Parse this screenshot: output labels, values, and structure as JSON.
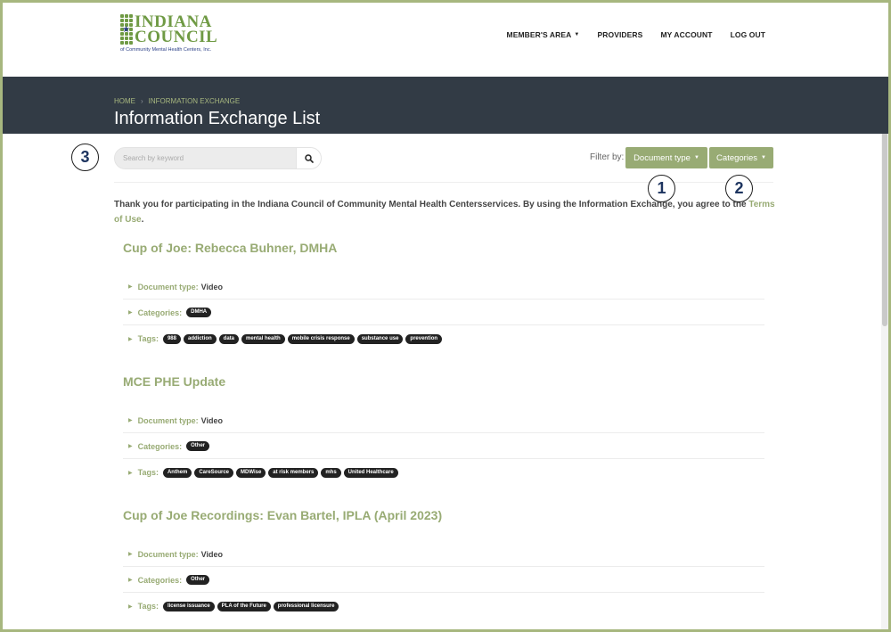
{
  "brand": {
    "logo_line1": "INDIANA",
    "logo_line2": "COUNCIL",
    "logo_tagline": "of Community Mental Health Centers, Inc.",
    "green": "#6f9a44",
    "navy": "#2b3f86"
  },
  "nav": {
    "items": [
      {
        "label": "MEMBER'S AREA",
        "has_dropdown": true
      },
      {
        "label": "PROVIDERS"
      },
      {
        "label": "MY ACCOUNT"
      },
      {
        "label": "LOG OUT"
      }
    ]
  },
  "breadcrumb": {
    "home": "HOME",
    "current": "INFORMATION EXCHANGE"
  },
  "page": {
    "title": "Information Exchange List"
  },
  "search": {
    "placeholder": "Search by keyword",
    "icon": "search-icon"
  },
  "filters": {
    "label": "Filter by:",
    "document_type": "Document type",
    "categories": "Categories",
    "button_color": "#98ab74"
  },
  "callouts": [
    "1",
    "2",
    "3"
  ],
  "intro": {
    "text": "Thank you for participating in the Indiana Council of Community Mental Health Centersservices. By using the Information Exchange, you agree to the ",
    "link": "Terms of Use",
    "end": "."
  },
  "labels": {
    "document_type": "Document type:",
    "categories": "Categories:",
    "tags": "Tags:"
  },
  "items": [
    {
      "title": "Cup of Joe: Rebecca Buhner, DMHA",
      "document_type": "Video",
      "categories": [
        "DMHA"
      ],
      "tags": [
        "988",
        "addiction",
        "data",
        "mental health",
        "mobile crisis response",
        "substance use",
        "prevention"
      ]
    },
    {
      "title": "MCE PHE Update",
      "document_type": "Video",
      "categories": [
        "Other"
      ],
      "tags": [
        "Anthem",
        "CareSource",
        "MDWise",
        "at risk members",
        "mhs",
        "United Healthcare"
      ]
    },
    {
      "title": "Cup of Joe Recordings: Evan Bartel, IPLA (April 2023)",
      "document_type": "Video",
      "categories": [
        "Other"
      ],
      "tags": [
        "license issuance",
        "PLA of the Future",
        "professional licensure"
      ]
    }
  ]
}
